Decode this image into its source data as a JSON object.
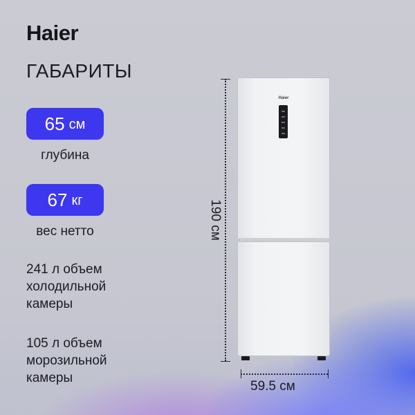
{
  "brand": {
    "logo_text": "Haier"
  },
  "heading": "ГАБАРИТЫ",
  "specs": {
    "depth": {
      "value": "65",
      "unit": "см",
      "label": "глубина"
    },
    "weight": {
      "value": "67",
      "unit": "кг",
      "label": "вес нетто"
    }
  },
  "descriptions": {
    "fridge": "241 л объем холодильной камеры",
    "freezer": "105 л объем морозильной камеры"
  },
  "dimensions": {
    "height": "190 см",
    "width": "59.5 см"
  },
  "product": {
    "logo_text": "Haier"
  },
  "colors": {
    "accent": "#3d37f0",
    "background": "#c9cad2",
    "text": "#1c1c22"
  }
}
